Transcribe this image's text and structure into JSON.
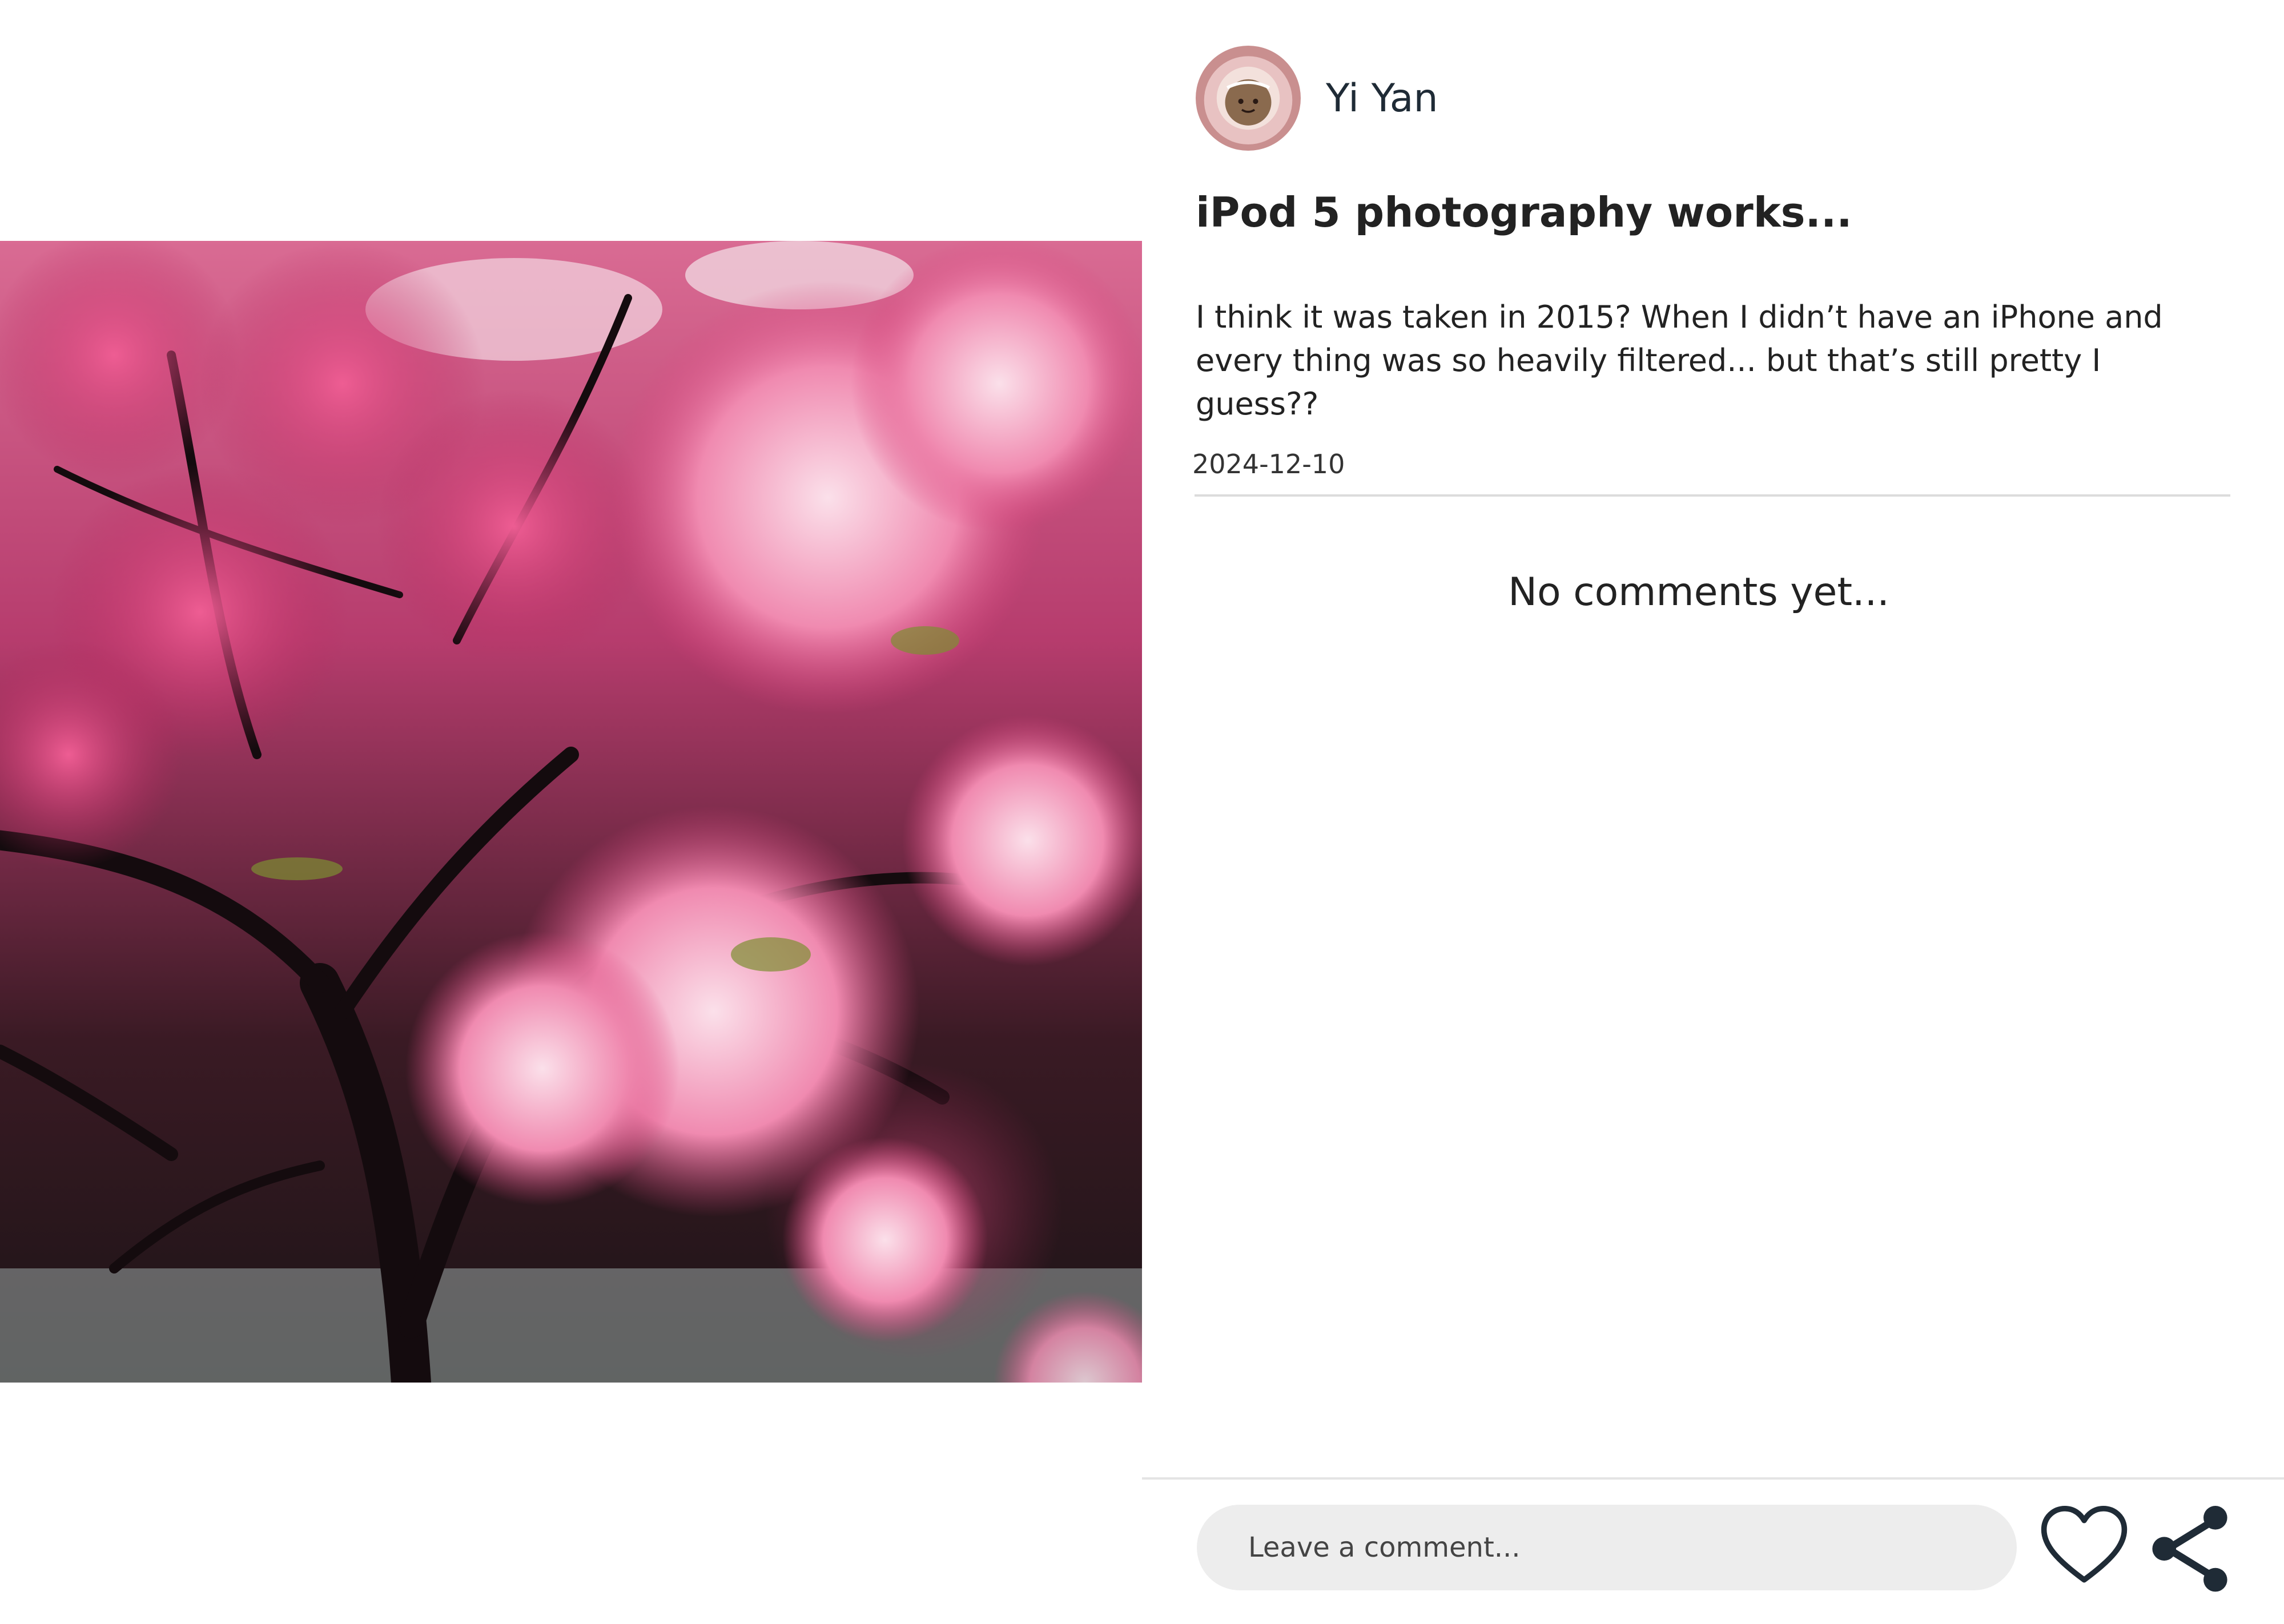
{
  "post": {
    "author_name": "Yi Yan",
    "avatar_icon": "avatar-flower-face",
    "title": "iPod 5 photography works...",
    "body": "I think it was taken in 2015? When I didn’t have an iPhone and every thing was so heavily filtered... but that’s still pretty I guess??",
    "date": "2024-12-10",
    "photo_subject": "cherry-blossom-tree-photo"
  },
  "comments": {
    "empty_text": "No comments yet..."
  },
  "actions": {
    "comment_placeholder": "Leave a comment...",
    "like_icon": "heart-icon",
    "share_icon": "share-icon"
  },
  "colors": {
    "icon": "#1f2b36",
    "input_bg": "#ededed",
    "divider": "#dcdcdc"
  }
}
